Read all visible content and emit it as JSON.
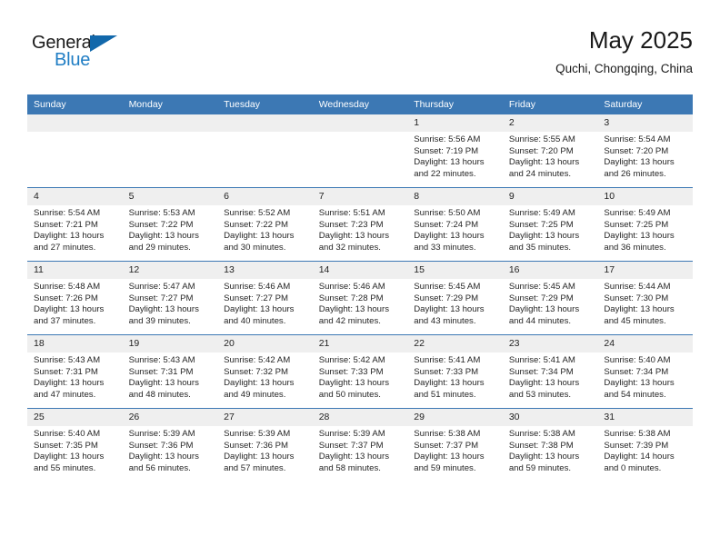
{
  "brand": {
    "name_part1": "General",
    "name_part2": "Blue",
    "triangle_icon": "triangle-icon",
    "accent_color": "#1f7dc4"
  },
  "header": {
    "title": "May 2025",
    "location": "Quchi, Chongqing, China"
  },
  "theme": {
    "header_blue": "#3c78b4",
    "daynum_gray": "#efefef",
    "text_color": "#262626"
  },
  "weekdays": [
    "Sunday",
    "Monday",
    "Tuesday",
    "Wednesday",
    "Thursday",
    "Friday",
    "Saturday"
  ],
  "labels": {
    "sunrise": "Sunrise:",
    "sunset": "Sunset:",
    "daylight": "Daylight:"
  },
  "weeks": [
    [
      {
        "day": "",
        "sunrise": "",
        "sunset": "",
        "daylight": "",
        "empty": true
      },
      {
        "day": "",
        "sunrise": "",
        "sunset": "",
        "daylight": "",
        "empty": true
      },
      {
        "day": "",
        "sunrise": "",
        "sunset": "",
        "daylight": "",
        "empty": true
      },
      {
        "day": "",
        "sunrise": "",
        "sunset": "",
        "daylight": "",
        "empty": true
      },
      {
        "day": "1",
        "sunrise": "Sunrise: 5:56 AM",
        "sunset": "Sunset: 7:19 PM",
        "daylight": "Daylight: 13 hours and 22 minutes."
      },
      {
        "day": "2",
        "sunrise": "Sunrise: 5:55 AM",
        "sunset": "Sunset: 7:20 PM",
        "daylight": "Daylight: 13 hours and 24 minutes."
      },
      {
        "day": "3",
        "sunrise": "Sunrise: 5:54 AM",
        "sunset": "Sunset: 7:20 PM",
        "daylight": "Daylight: 13 hours and 26 minutes."
      }
    ],
    [
      {
        "day": "4",
        "sunrise": "Sunrise: 5:54 AM",
        "sunset": "Sunset: 7:21 PM",
        "daylight": "Daylight: 13 hours and 27 minutes."
      },
      {
        "day": "5",
        "sunrise": "Sunrise: 5:53 AM",
        "sunset": "Sunset: 7:22 PM",
        "daylight": "Daylight: 13 hours and 29 minutes."
      },
      {
        "day": "6",
        "sunrise": "Sunrise: 5:52 AM",
        "sunset": "Sunset: 7:22 PM",
        "daylight": "Daylight: 13 hours and 30 minutes."
      },
      {
        "day": "7",
        "sunrise": "Sunrise: 5:51 AM",
        "sunset": "Sunset: 7:23 PM",
        "daylight": "Daylight: 13 hours and 32 minutes."
      },
      {
        "day": "8",
        "sunrise": "Sunrise: 5:50 AM",
        "sunset": "Sunset: 7:24 PM",
        "daylight": "Daylight: 13 hours and 33 minutes."
      },
      {
        "day": "9",
        "sunrise": "Sunrise: 5:49 AM",
        "sunset": "Sunset: 7:25 PM",
        "daylight": "Daylight: 13 hours and 35 minutes."
      },
      {
        "day": "10",
        "sunrise": "Sunrise: 5:49 AM",
        "sunset": "Sunset: 7:25 PM",
        "daylight": "Daylight: 13 hours and 36 minutes."
      }
    ],
    [
      {
        "day": "11",
        "sunrise": "Sunrise: 5:48 AM",
        "sunset": "Sunset: 7:26 PM",
        "daylight": "Daylight: 13 hours and 37 minutes."
      },
      {
        "day": "12",
        "sunrise": "Sunrise: 5:47 AM",
        "sunset": "Sunset: 7:27 PM",
        "daylight": "Daylight: 13 hours and 39 minutes."
      },
      {
        "day": "13",
        "sunrise": "Sunrise: 5:46 AM",
        "sunset": "Sunset: 7:27 PM",
        "daylight": "Daylight: 13 hours and 40 minutes."
      },
      {
        "day": "14",
        "sunrise": "Sunrise: 5:46 AM",
        "sunset": "Sunset: 7:28 PM",
        "daylight": "Daylight: 13 hours and 42 minutes."
      },
      {
        "day": "15",
        "sunrise": "Sunrise: 5:45 AM",
        "sunset": "Sunset: 7:29 PM",
        "daylight": "Daylight: 13 hours and 43 minutes."
      },
      {
        "day": "16",
        "sunrise": "Sunrise: 5:45 AM",
        "sunset": "Sunset: 7:29 PM",
        "daylight": "Daylight: 13 hours and 44 minutes."
      },
      {
        "day": "17",
        "sunrise": "Sunrise: 5:44 AM",
        "sunset": "Sunset: 7:30 PM",
        "daylight": "Daylight: 13 hours and 45 minutes."
      }
    ],
    [
      {
        "day": "18",
        "sunrise": "Sunrise: 5:43 AM",
        "sunset": "Sunset: 7:31 PM",
        "daylight": "Daylight: 13 hours and 47 minutes."
      },
      {
        "day": "19",
        "sunrise": "Sunrise: 5:43 AM",
        "sunset": "Sunset: 7:31 PM",
        "daylight": "Daylight: 13 hours and 48 minutes."
      },
      {
        "day": "20",
        "sunrise": "Sunrise: 5:42 AM",
        "sunset": "Sunset: 7:32 PM",
        "daylight": "Daylight: 13 hours and 49 minutes."
      },
      {
        "day": "21",
        "sunrise": "Sunrise: 5:42 AM",
        "sunset": "Sunset: 7:33 PM",
        "daylight": "Daylight: 13 hours and 50 minutes."
      },
      {
        "day": "22",
        "sunrise": "Sunrise: 5:41 AM",
        "sunset": "Sunset: 7:33 PM",
        "daylight": "Daylight: 13 hours and 51 minutes."
      },
      {
        "day": "23",
        "sunrise": "Sunrise: 5:41 AM",
        "sunset": "Sunset: 7:34 PM",
        "daylight": "Daylight: 13 hours and 53 minutes."
      },
      {
        "day": "24",
        "sunrise": "Sunrise: 5:40 AM",
        "sunset": "Sunset: 7:34 PM",
        "daylight": "Daylight: 13 hours and 54 minutes."
      }
    ],
    [
      {
        "day": "25",
        "sunrise": "Sunrise: 5:40 AM",
        "sunset": "Sunset: 7:35 PM",
        "daylight": "Daylight: 13 hours and 55 minutes."
      },
      {
        "day": "26",
        "sunrise": "Sunrise: 5:39 AM",
        "sunset": "Sunset: 7:36 PM",
        "daylight": "Daylight: 13 hours and 56 minutes."
      },
      {
        "day": "27",
        "sunrise": "Sunrise: 5:39 AM",
        "sunset": "Sunset: 7:36 PM",
        "daylight": "Daylight: 13 hours and 57 minutes."
      },
      {
        "day": "28",
        "sunrise": "Sunrise: 5:39 AM",
        "sunset": "Sunset: 7:37 PM",
        "daylight": "Daylight: 13 hours and 58 minutes."
      },
      {
        "day": "29",
        "sunrise": "Sunrise: 5:38 AM",
        "sunset": "Sunset: 7:37 PM",
        "daylight": "Daylight: 13 hours and 59 minutes."
      },
      {
        "day": "30",
        "sunrise": "Sunrise: 5:38 AM",
        "sunset": "Sunset: 7:38 PM",
        "daylight": "Daylight: 13 hours and 59 minutes."
      },
      {
        "day": "31",
        "sunrise": "Sunrise: 5:38 AM",
        "sunset": "Sunset: 7:39 PM",
        "daylight": "Daylight: 14 hours and 0 minutes."
      }
    ]
  ]
}
